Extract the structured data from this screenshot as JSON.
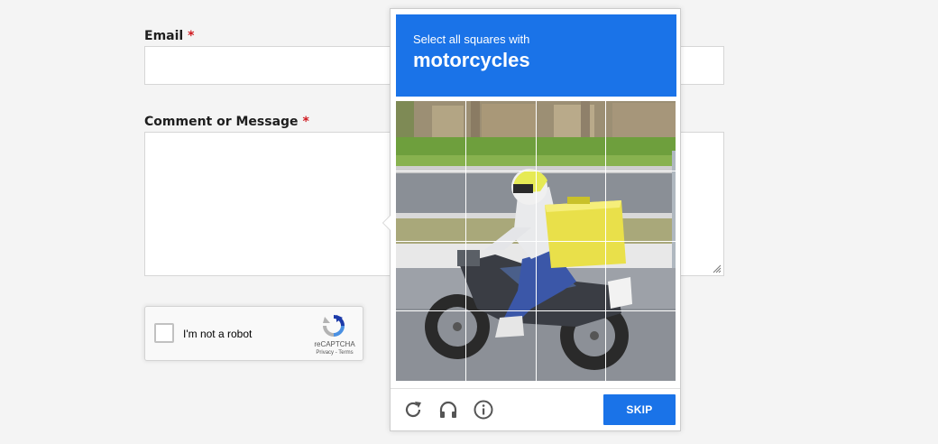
{
  "form": {
    "email_label": "Email",
    "required_mark": "*",
    "message_label": "Comment or Message"
  },
  "recaptcha_widget": {
    "label": "I'm not a robot",
    "brand": "reCAPTCHA",
    "links": "Privacy - Terms"
  },
  "challenge": {
    "instruction": "Select all squares with",
    "target": "motorcycles",
    "grid_size": "4x4",
    "skip_label": "SKIP"
  },
  "icons": {
    "reload": "reload-icon",
    "audio": "headphones-icon",
    "info": "info-icon"
  },
  "colors": {
    "accent": "#1a73e8",
    "required": "#d0191f",
    "background": "#f4f4f4"
  }
}
